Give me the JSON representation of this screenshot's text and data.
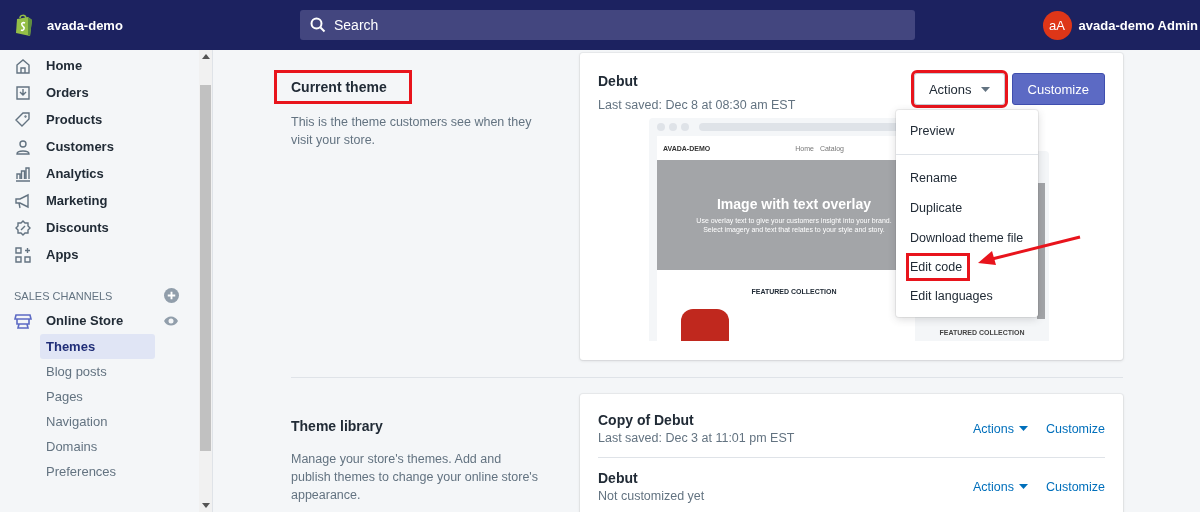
{
  "top_bar": {
    "store_name": "avada-demo",
    "search": {
      "placeholder": "Search"
    },
    "avatar_initials": "aA",
    "account_name": "avada-demo Admin"
  },
  "sidebar": {
    "items": [
      {
        "label": "Home"
      },
      {
        "label": "Orders"
      },
      {
        "label": "Products"
      },
      {
        "label": "Customers"
      },
      {
        "label": "Analytics"
      },
      {
        "label": "Marketing"
      },
      {
        "label": "Discounts"
      },
      {
        "label": "Apps"
      }
    ],
    "sales_channels": {
      "heading": "SALES CHANNELS",
      "channel": {
        "label": "Online Store",
        "items": [
          {
            "label": "Themes",
            "selected": true
          },
          {
            "label": "Blog posts",
            "selected": false
          },
          {
            "label": "Pages",
            "selected": false
          },
          {
            "label": "Navigation",
            "selected": false
          },
          {
            "label": "Domains",
            "selected": false
          },
          {
            "label": "Preferences",
            "selected": false
          }
        ]
      }
    }
  },
  "current_theme": {
    "heading": "Current theme",
    "highlighted": true,
    "description": "This is the theme customers see when they visit your store.",
    "theme": {
      "name": "Debut",
      "last_saved": "Last saved: Dec 8 at 08:30 am EST",
      "actions": {
        "label": "Actions",
        "highlighted": true
      },
      "customize": "Customize",
      "preview": {
        "site_name": "AVADA-DEMO",
        "nav": [
          "Home",
          "Catalog"
        ],
        "hero_title": "Image with text overlay",
        "hero_text": "Use overlay text to give your customers insight into your brand. Select imagery and text that relates to your style and story.",
        "collection_heading": "FEATURED COLLECTION",
        "mobile_collection_heading": "FEATURED COLLECTION"
      },
      "menu": {
        "sections": [
          {
            "items": [
              {
                "label": "Preview",
                "highlighted": false
              }
            ]
          },
          {
            "items": [
              {
                "label": "Rename",
                "highlighted": false
              },
              {
                "label": "Duplicate",
                "highlighted": false
              },
              {
                "label": "Download theme file",
                "highlighted": false
              },
              {
                "label": "Edit code",
                "highlighted": true
              },
              {
                "label": "Edit languages",
                "highlighted": false
              }
            ]
          }
        ]
      }
    }
  },
  "theme_library": {
    "heading": "Theme library",
    "description": "Manage your store's themes. Add and publish themes to change your online store's appearance.",
    "themes": [
      {
        "name": "Copy of Debut",
        "status": "Last saved: Dec 3 at 11:01 pm EST",
        "actions": "Actions",
        "customize": "Customize"
      },
      {
        "name": "Debut",
        "status": "Not customized yet",
        "actions": "Actions",
        "customize": "Customize"
      }
    ]
  }
}
